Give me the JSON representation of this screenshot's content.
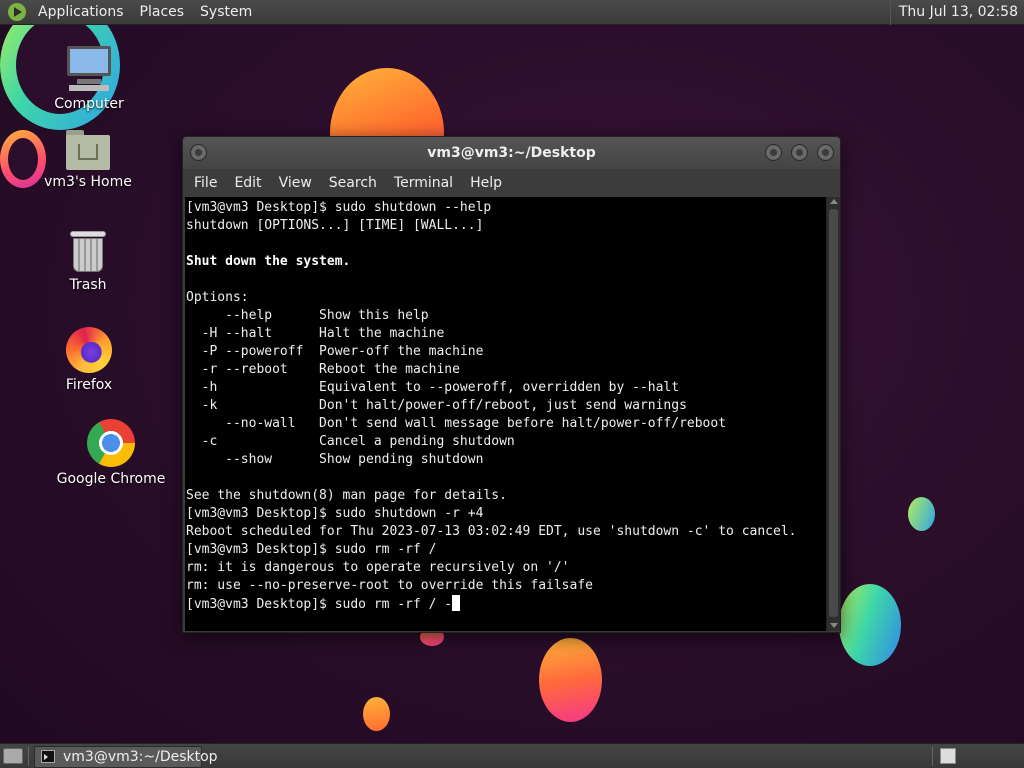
{
  "top_panel": {
    "menus": [
      "Applications",
      "Places",
      "System"
    ],
    "clock": "Thu Jul 13, 02:58"
  },
  "desktop_icons": [
    {
      "label": "Computer",
      "icon": "computer-icon"
    },
    {
      "label": "vm3's Home",
      "icon": "home-folder-icon"
    },
    {
      "label": "Trash",
      "icon": "trash-icon"
    },
    {
      "label": "Firefox",
      "icon": "firefox-icon"
    },
    {
      "label": "Google Chrome",
      "icon": "chrome-icon"
    }
  ],
  "terminal": {
    "title": "vm3@vm3:~/Desktop",
    "menu": [
      "File",
      "Edit",
      "View",
      "Search",
      "Terminal",
      "Help"
    ],
    "lines": [
      "[vm3@vm3 Desktop]$ sudo shutdown --help",
      "shutdown [OPTIONS...] [TIME] [WALL...]",
      "",
      "Shut down the system.",
      "",
      "Options:",
      "     --help      Show this help",
      "  -H --halt      Halt the machine",
      "  -P --poweroff  Power-off the machine",
      "  -r --reboot    Reboot the machine",
      "  -h             Equivalent to --poweroff, overridden by --halt",
      "  -k             Don't halt/power-off/reboot, just send warnings",
      "     --no-wall   Don't send wall message before halt/power-off/reboot",
      "  -c             Cancel a pending shutdown",
      "     --show      Show pending shutdown",
      "",
      "See the shutdown(8) man page for details.",
      "[vm3@vm3 Desktop]$ sudo shutdown -r +4",
      "Reboot scheduled for Thu 2023-07-13 03:02:49 EDT, use 'shutdown -c' to cancel.",
      "[vm3@vm3 Desktop]$ sudo rm -rf /",
      "rm: it is dangerous to operate recursively on '/'",
      "rm: use --no-preserve-root to override this failsafe"
    ],
    "current_input": "[vm3@vm3 Desktop]$ sudo rm -rf / -"
  },
  "taskbar": {
    "task_label": "vm3@vm3:~/Desktop"
  }
}
